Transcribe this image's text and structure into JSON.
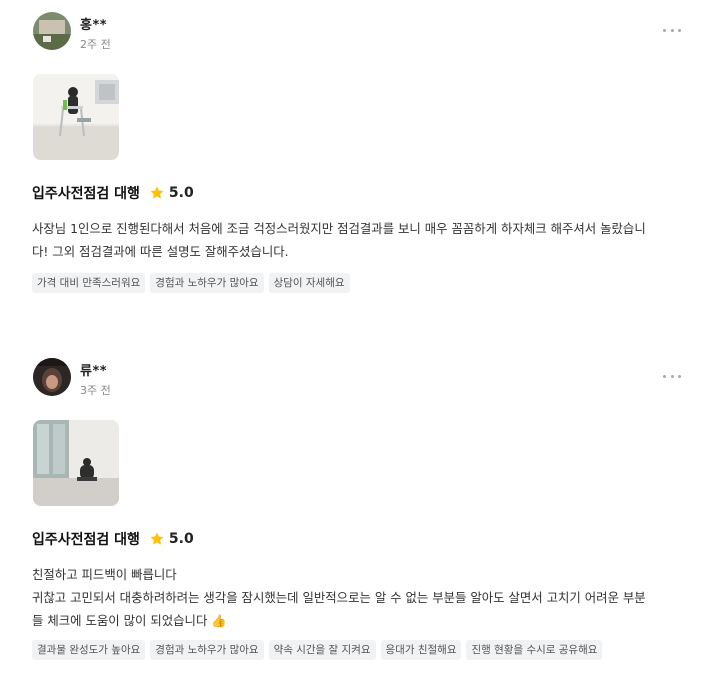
{
  "reviews": [
    {
      "name": "홍**",
      "date": "2주 전",
      "service": "입주사전점검 대행",
      "score": "5.0",
      "text": "사장님 1인으로 진행된다해서 처음에 조금 걱정스러웠지만 점검결과를 보니 매우 꼼꼼하게 하자체크 해주셔서 놀랐습니\n다! 그외 점검결과에 따른 설명도 잘해주셨습니다.",
      "tags": [
        "가격 대비 만족스러워요",
        "경험과 노하우가 많아요",
        "상담이 자세해요"
      ],
      "more_icon": "more-horizontal-icon"
    },
    {
      "name": "류**",
      "date": "3주 전",
      "service": "입주사전점검 대행",
      "score": "5.0",
      "text": "친절하고 피드백이 빠릅니다\n귀찮고 고민되서 대충하려하려는 생각을 잠시했는데 일반적으로는 알 수 없는 부분들 알아도 살면서 고치기 어려운 부분\n들 체크에 도움이 많이 되었습니다 👍",
      "tags": [
        "결과물 완성도가 높아요",
        "경험과 노하우가 많아요",
        "약속 시간을 잘 지켜요",
        "응대가 친절해요",
        "진행 현황을 수시로 공유해요"
      ],
      "more_icon": "more-horizontal-icon"
    }
  ],
  "colors": {
    "star": "#FFC107",
    "tag_bg": "#F1F2F4"
  }
}
